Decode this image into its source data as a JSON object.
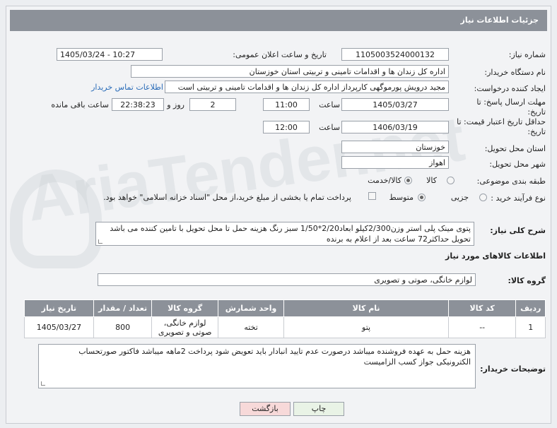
{
  "header": {
    "title": "جزئیات اطلاعات نیاز"
  },
  "fields": {
    "need_number_label": "شماره نیاز:",
    "need_number": "1105003524000132",
    "announce_label": "تاریخ و ساعت اعلان عمومی:",
    "announce_value": "1405/03/24 - 10:27",
    "buyer_org_label": "نام دستگاه خریدار:",
    "buyer_org": "اداره کل زندان ها و اقدامات تامینی و تربیتی استان خوزستان",
    "requester_label": "ایجاد کننده درخواست:",
    "requester": "مجید درویش پورموگهی کارپرداز اداره کل زندان ها و اقدامات تامینی و تربیتی است",
    "contact_link": "اطلاعات تماس خریدار",
    "deadline_label": "مهلت ارسال پاسخ: تا تاریخ:",
    "deadline_date": "1405/03/27",
    "hour_label": "ساعت",
    "deadline_time": "11:00",
    "days_value": "2",
    "day_word": "روز و",
    "remaining_time": "22:38:23",
    "remaining_label": "ساعت باقی مانده",
    "price_validity_label": "حداقل تاریخ اعتبار قیمت: تا تاریخ:",
    "price_date": "1406/03/19",
    "price_time": "12:00",
    "province_label": "استان محل تحویل:",
    "province": "خوزستان",
    "city_label": "شهر محل تحویل:",
    "city": "اهواز",
    "category_label": "طبقه بندی موضوعی:",
    "cat_goods": "کالا",
    "cat_goods_service": "کالا/خدمت",
    "process_label": "نوع فرآیند خرید :",
    "proc_partial": "جزیی",
    "proc_medium": "متوسط",
    "payment_note": "پرداخت تمام یا بخشی از مبلغ خرید،از محل \"اسناد خزانه اسلامی\" خواهد بود."
  },
  "description": {
    "label": "شرح کلی نیاز:",
    "text": "پتوی مینک پلی استر وزن2/300کیلو ابعاد2/20*1/50 سبز رنگ هزینه حمل تا محل تحویل با تامین کننده می باشد تحویل حداکثر72 ساعت بعد از اعلام به برنده"
  },
  "goods_info": {
    "title": "اطلاعات کالاهای مورد نیاز",
    "group_label": "گروه کالا:",
    "group_value": "لوازم خانگی، صوتی و تصویری"
  },
  "table": {
    "headers": [
      "ردیف",
      "کد کالا",
      "نام کالا",
      "واحد شمارش",
      "گروه کالا",
      "تعداد / مقدار",
      "تاریخ نیاز"
    ],
    "rows": [
      [
        "1",
        "--",
        "پتو",
        "تخته",
        "لوازم خانگی، صوتی و تصویری",
        "800",
        "1405/03/27"
      ]
    ]
  },
  "buyer_notes": {
    "label": "توضیحات خریدار:",
    "text": "هزینه حمل به عهده فروشنده میباشد درصورت عدم تایید انبادار باید تعویض شود پرداخت 2ماهه میباشد فاکتور صورتحساب الکترونیکی جواز کسب الزامیست"
  },
  "buttons": {
    "print": "چاپ",
    "back": "بازگشت"
  },
  "watermark": "AriaTender.net"
}
